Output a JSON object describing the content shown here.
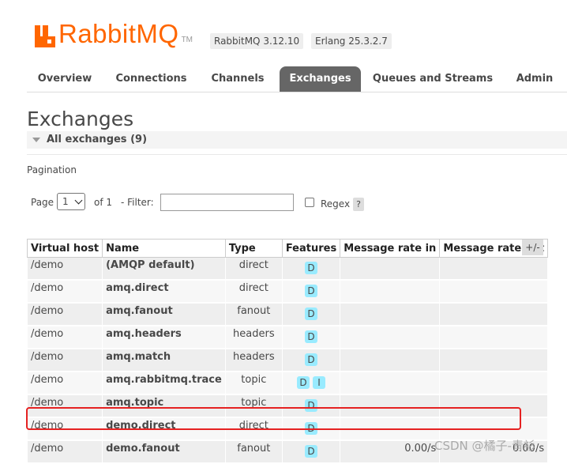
{
  "brand": {
    "logo_text": "RabbitMQ",
    "tm": "TM",
    "accent": "#ff6600"
  },
  "versions": {
    "rabbitmq": "RabbitMQ 3.12.10",
    "erlang": "Erlang 25.3.2.7"
  },
  "nav": {
    "tabs": [
      {
        "label": "Overview"
      },
      {
        "label": "Connections"
      },
      {
        "label": "Channels"
      },
      {
        "label": "Exchanges",
        "active": true
      },
      {
        "label": "Queues and Streams"
      },
      {
        "label": "Admin"
      }
    ]
  },
  "page": {
    "title": "Exchanges",
    "section": "All exchanges (9)"
  },
  "pagination": {
    "heading": "Pagination",
    "page_label": "Page",
    "page_value": "1",
    "of_label": "of 1",
    "filter_label": "- Filter:",
    "filter_value": "",
    "regex_label": "Regex",
    "help_label": "?"
  },
  "table": {
    "headers": [
      "Virtual host",
      "Name",
      "Type",
      "Features",
      "Message rate in",
      "Message rate out"
    ],
    "toggle_label": "+/-",
    "rows": [
      {
        "vhost": "/demo",
        "name": "(AMQP default)",
        "type": "direct",
        "features": [
          "D"
        ],
        "rate_in": "",
        "rate_out": ""
      },
      {
        "vhost": "/demo",
        "name": "amq.direct",
        "type": "direct",
        "features": [
          "D"
        ],
        "rate_in": "",
        "rate_out": ""
      },
      {
        "vhost": "/demo",
        "name": "amq.fanout",
        "type": "fanout",
        "features": [
          "D"
        ],
        "rate_in": "",
        "rate_out": ""
      },
      {
        "vhost": "/demo",
        "name": "amq.headers",
        "type": "headers",
        "features": [
          "D"
        ],
        "rate_in": "",
        "rate_out": ""
      },
      {
        "vhost": "/demo",
        "name": "amq.match",
        "type": "headers",
        "features": [
          "D"
        ],
        "rate_in": "",
        "rate_out": ""
      },
      {
        "vhost": "/demo",
        "name": "amq.rabbitmq.trace",
        "type": "topic",
        "features": [
          "D",
          "I"
        ],
        "rate_in": "",
        "rate_out": ""
      },
      {
        "vhost": "/demo",
        "name": "amq.topic",
        "type": "topic",
        "features": [
          "D"
        ],
        "rate_in": "",
        "rate_out": ""
      },
      {
        "vhost": "/demo",
        "name": "demo.direct",
        "type": "direct",
        "features": [
          "D"
        ],
        "rate_in": "",
        "rate_out": ""
      },
      {
        "vhost": "/demo",
        "name": "demo.fanout",
        "type": "fanout",
        "features": [
          "D"
        ],
        "rate_in": "0.00/s",
        "rate_out": "0.00/s"
      }
    ]
  },
  "watermark": "CSDN @橘子-青衫"
}
